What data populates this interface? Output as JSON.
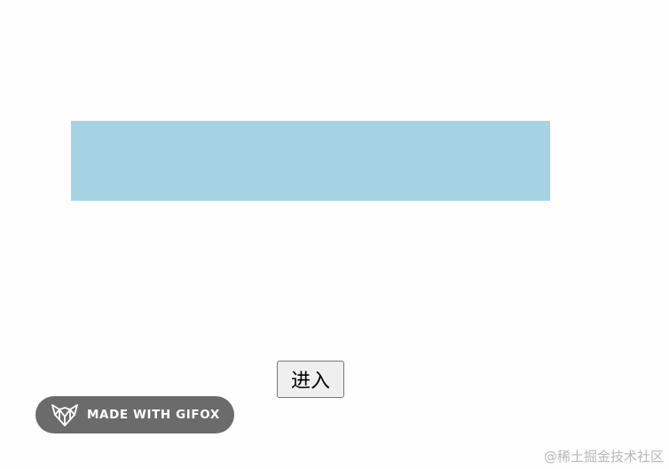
{
  "colors": {
    "block": "#a6d3e3",
    "badge": "#6b6b6b",
    "watermark": "#b8b8b8"
  },
  "enter_button": {
    "label": "进入"
  },
  "gifox_badge": {
    "icon": "fox-icon",
    "text": "MADE WITH GIFOX"
  },
  "watermark": {
    "text": "@稀土掘金技术社区"
  }
}
